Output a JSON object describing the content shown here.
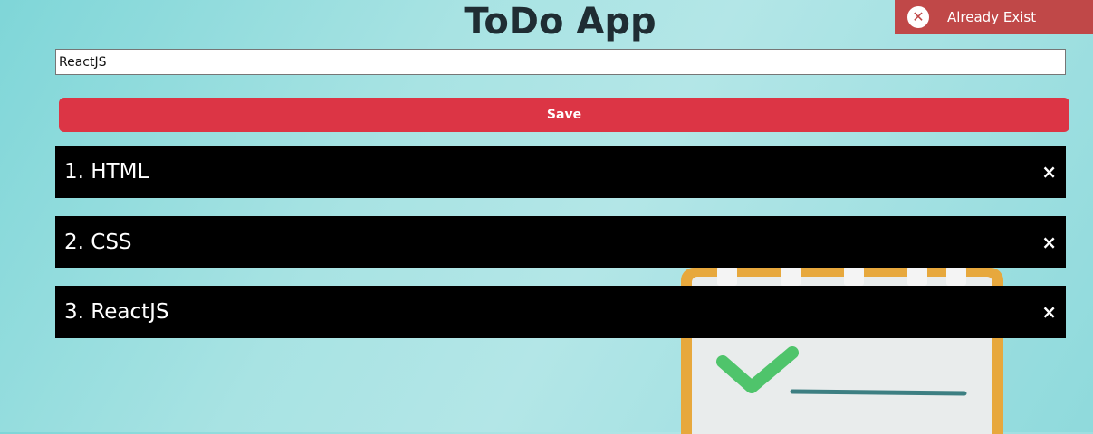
{
  "app": {
    "title": "ToDo App"
  },
  "toast": {
    "icon": "close-circle-icon",
    "message": "Already Exist",
    "color": "#c04848"
  },
  "form": {
    "input_value": "ReactJS",
    "save_label": "Save",
    "save_color": "#dc3545"
  },
  "todos": [
    {
      "label": "1. HTML",
      "delete_icon": "×"
    },
    {
      "label": "2. CSS",
      "delete_icon": "×"
    },
    {
      "label": "3. ReactJS",
      "delete_icon": "×"
    }
  ]
}
